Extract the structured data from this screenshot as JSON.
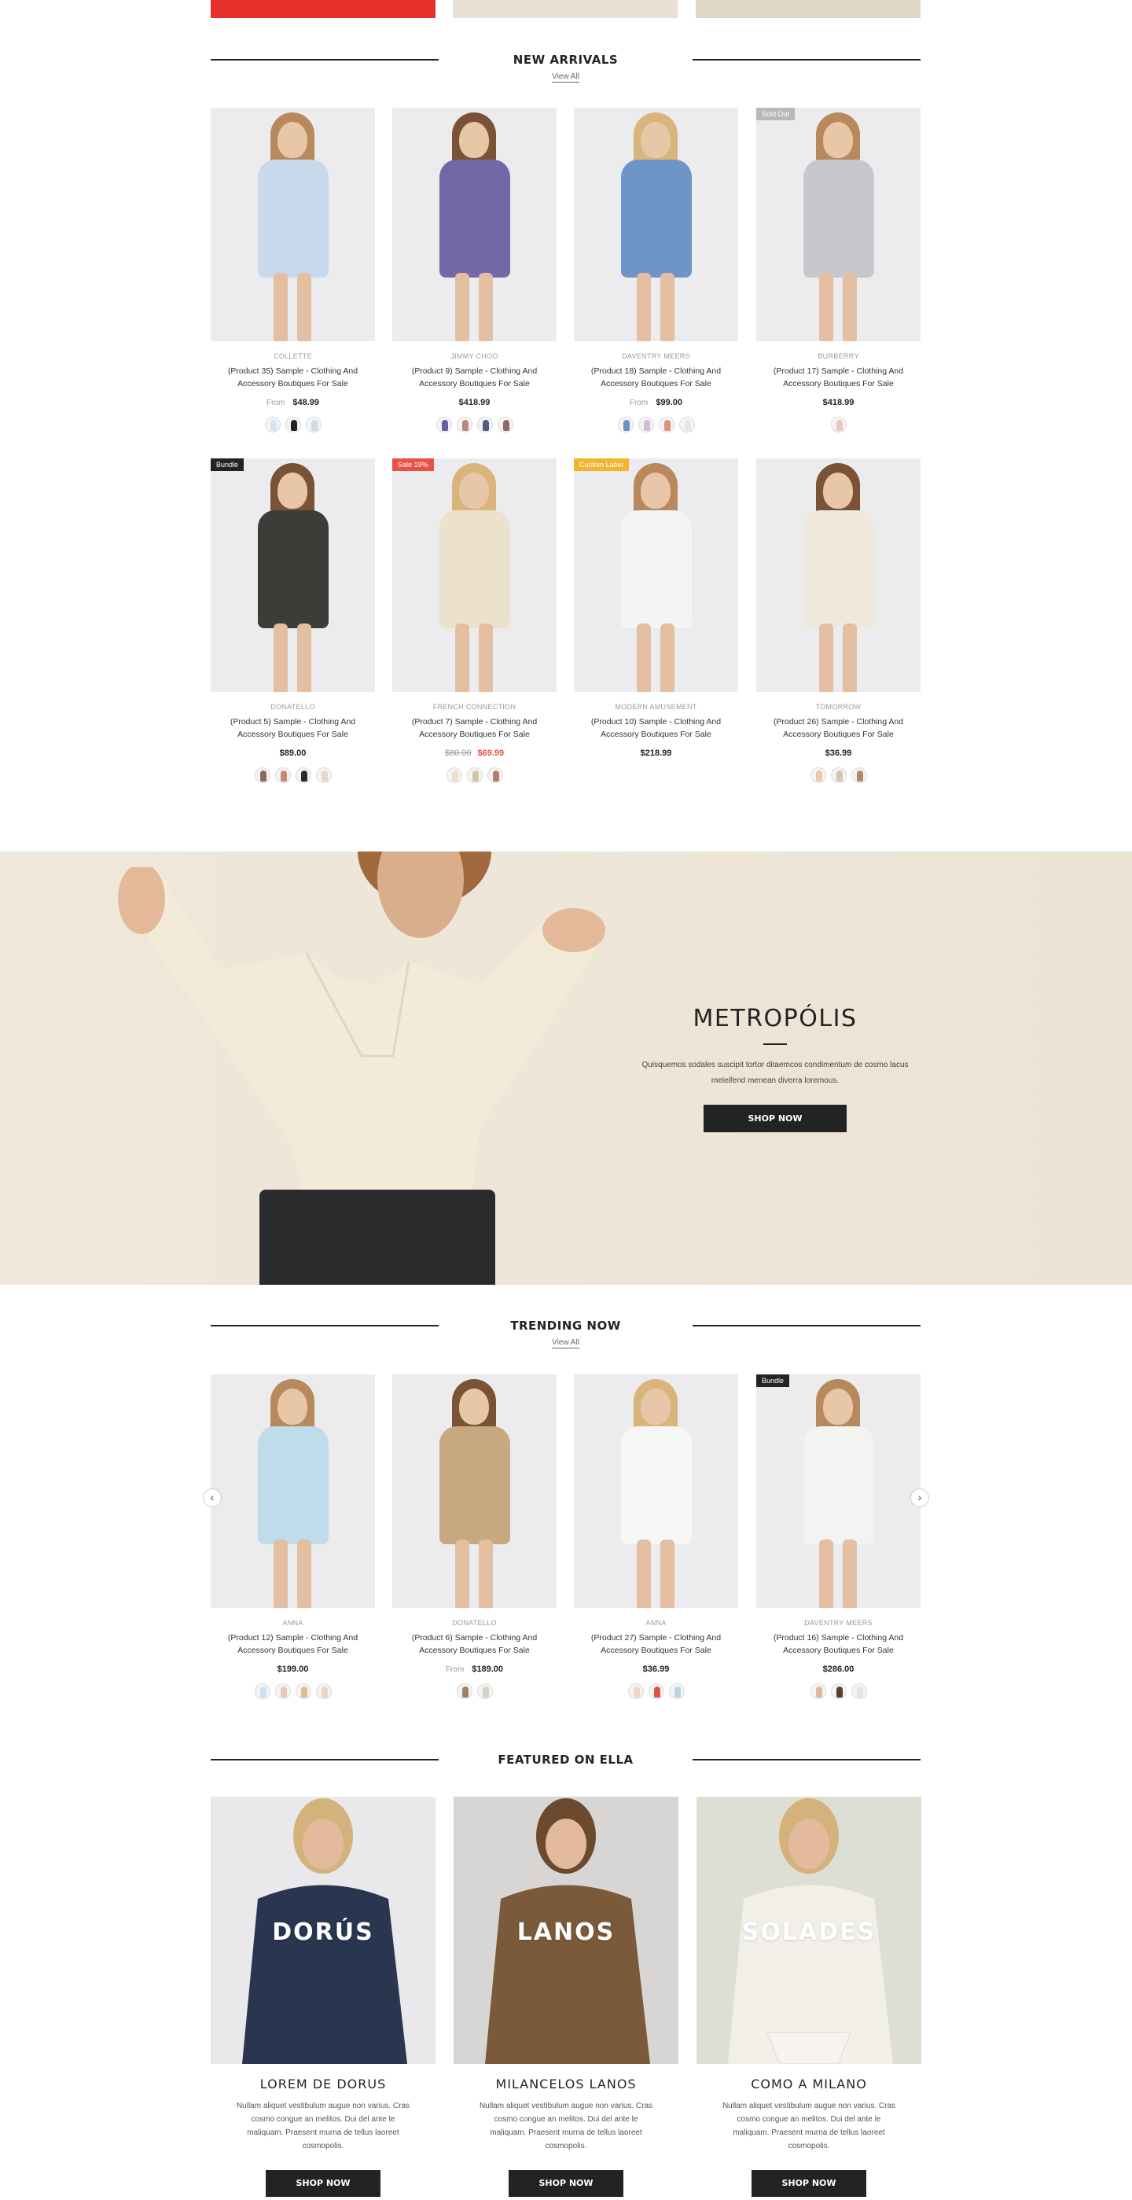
{
  "new_arrivals": {
    "title": "NEW ARRIVALS",
    "view_all": "View All",
    "products": [
      {
        "vendor": "COLLETTE",
        "name": "(Product 35) Sample - Clothing And Accessory Boutiques For Sale",
        "from": "From",
        "price": "$48.99",
        "badge": "",
        "colors": [
          "#d7e4ef",
          "#222222",
          "#cfdbe6"
        ],
        "outfit": "#c7d9ea"
      },
      {
        "vendor": "JIMMY CHOO",
        "name": "(Product 9) Sample - Clothing And Accessory Boutiques For Sale",
        "from": "",
        "price": "$418.99",
        "badge": "",
        "colors": [
          "#6a5f9c",
          "#b38b76",
          "#565b80",
          "#8b6b63"
        ],
        "outfit": "#7467a8"
      },
      {
        "vendor": "DAVENTRY MEERS",
        "name": "(Product 18) Sample - Clothing And Accessory Boutiques For Sale",
        "from": "From",
        "price": "$99.00",
        "badge": "",
        "colors": [
          "#6f8fbf",
          "#d9b8d8",
          "#e4907c",
          "#f1e3e3"
        ],
        "outfit": "#6f94c6"
      },
      {
        "vendor": "BURBERRY",
        "name": "(Product 17) Sample - Clothing And Accessory Boutiques For Sale",
        "from": "",
        "price": "$418.99",
        "badge": "Sold Out",
        "colors": [
          "#e6c8b8"
        ],
        "outfit": "#c8c8cc"
      },
      {
        "vendor": "DONATELLO",
        "name": "(Product 5) Sample - Clothing And Accessory Boutiques For Sale",
        "from": "",
        "price": "$89.00",
        "badge": "Bundle",
        "colors": [
          "#8a6a5a",
          "#c58a70",
          "#2a2a34",
          "#e9d6c9"
        ],
        "outfit": "#3a3d38"
      },
      {
        "vendor": "FRENCH CONNECTION",
        "name": "(Product 7) Sample - Clothing And Accessory Boutiques For Sale",
        "from": "",
        "price": "$69.99",
        "old_price": "$80.00",
        "badge": "Sale 19%",
        "colors": [
          "#efe0cc",
          "#d7c5a8",
          "#b87b68"
        ],
        "outfit": "#ece2cc"
      },
      {
        "vendor": "MODERN AMUSEMENT",
        "name": "(Product 10) Sample - Clothing And Accessory Boutiques For Sale",
        "from": "",
        "price": "$218.99",
        "badge": "Custom Label",
        "colors": [],
        "outfit": "#f4f4f2"
      },
      {
        "vendor": "TOMORROW",
        "name": "(Product 26) Sample - Clothing And Accessory Boutiques For Sale",
        "from": "",
        "price": "$36.99",
        "badge": "",
        "colors": [
          "#e8c9b2",
          "#d9c6b0",
          "#b7866f"
        ],
        "outfit": "#efe9dd"
      }
    ]
  },
  "banner": {
    "title": "METROPÓLIS",
    "description": "Quisquemos sodales suscipit tortor ditaemcos condimentum de cosmo lacus meleifend menean diverra loremous.",
    "button": "SHOP NOW"
  },
  "trending": {
    "title": "TRENDING NOW",
    "view_all": "View All",
    "prev_icon": "‹",
    "next_icon": "›",
    "products": [
      {
        "vendor": "ANNA",
        "name": "(Product 12) Sample - Clothing And Accessory Boutiques For Sale",
        "from": "",
        "price": "$199.00",
        "badge": "",
        "colors": [
          "#cfe3ef",
          "#e9c7b0",
          "#d8c090",
          "#f0d2c0"
        ],
        "outfit": "#bfdcea"
      },
      {
        "vendor": "DONATELLO",
        "name": "(Product 6) Sample - Clothing And Accessory Boutiques For Sale",
        "from": "From",
        "price": "$189.00",
        "badge": "",
        "colors": [
          "#a08060",
          "#d9cfc4"
        ],
        "outfit": "#c8a880"
      },
      {
        "vendor": "ANNA",
        "name": "(Product 27) Sample - Clothing And Accessory Boutiques For Sale",
        "from": "",
        "price": "$36.99",
        "badge": "",
        "colors": [
          "#f3d5c2",
          "#d9573f",
          "#b9d3e4"
        ],
        "outfit": "#f6f6f6"
      },
      {
        "vendor": "DAVENTRY MEERS",
        "name": "(Product 16) Sample - Clothing And Accessory Boutiques For Sale",
        "from": "",
        "price": "$286.00",
        "badge": "Bundle",
        "colors": [
          "#e0b79c",
          "#5c3d2e",
          "#e7e4df"
        ],
        "outfit": "#f3f3f1"
      }
    ]
  },
  "featured": {
    "title": "FEATURED ON ELLA",
    "items": [
      {
        "label": "DORÚS",
        "title": "LOREM DE DORUS",
        "description": "Nullam aliquet vestibulum augue non varius. Cras cosmo congue an melitos. Dui del ante le maliquam. Praesent murna de tellus laoreet cosmopolis.",
        "button": "SHOP NOW",
        "bg": "#e9e8ea",
        "garment": "#2a3550"
      },
      {
        "label": "LANOS",
        "title": "MILANCELOS LANOS",
        "description": "Nullam aliquet vestibulum augue non varius. Cras cosmo congue an melitos. Dui del ante le maliquam. Praesent murna de tellus laoreet cosmopolis.",
        "button": "SHOP NOW",
        "bg": "#d8d6d4",
        "garment": "#7a5a3a"
      },
      {
        "label": "SOLADES",
        "title": "COMO A MILANO",
        "description": "Nullam aliquet vestibulum augue non varius. Cras cosmo congue an melitos. Dui del ante le maliquam. Praesent murna de tellus laoreet cosmopolis.",
        "button": "SHOP NOW",
        "bg": "#dedfd4",
        "garment": "#f1efe8"
      }
    ]
  },
  "colors": {
    "accent": "#232323",
    "sale": "#e95144",
    "sold_out": "#b9b9b9",
    "bundle": "#232323",
    "sale_badge": "#e95144",
    "custom_label": "#f4b52e"
  }
}
